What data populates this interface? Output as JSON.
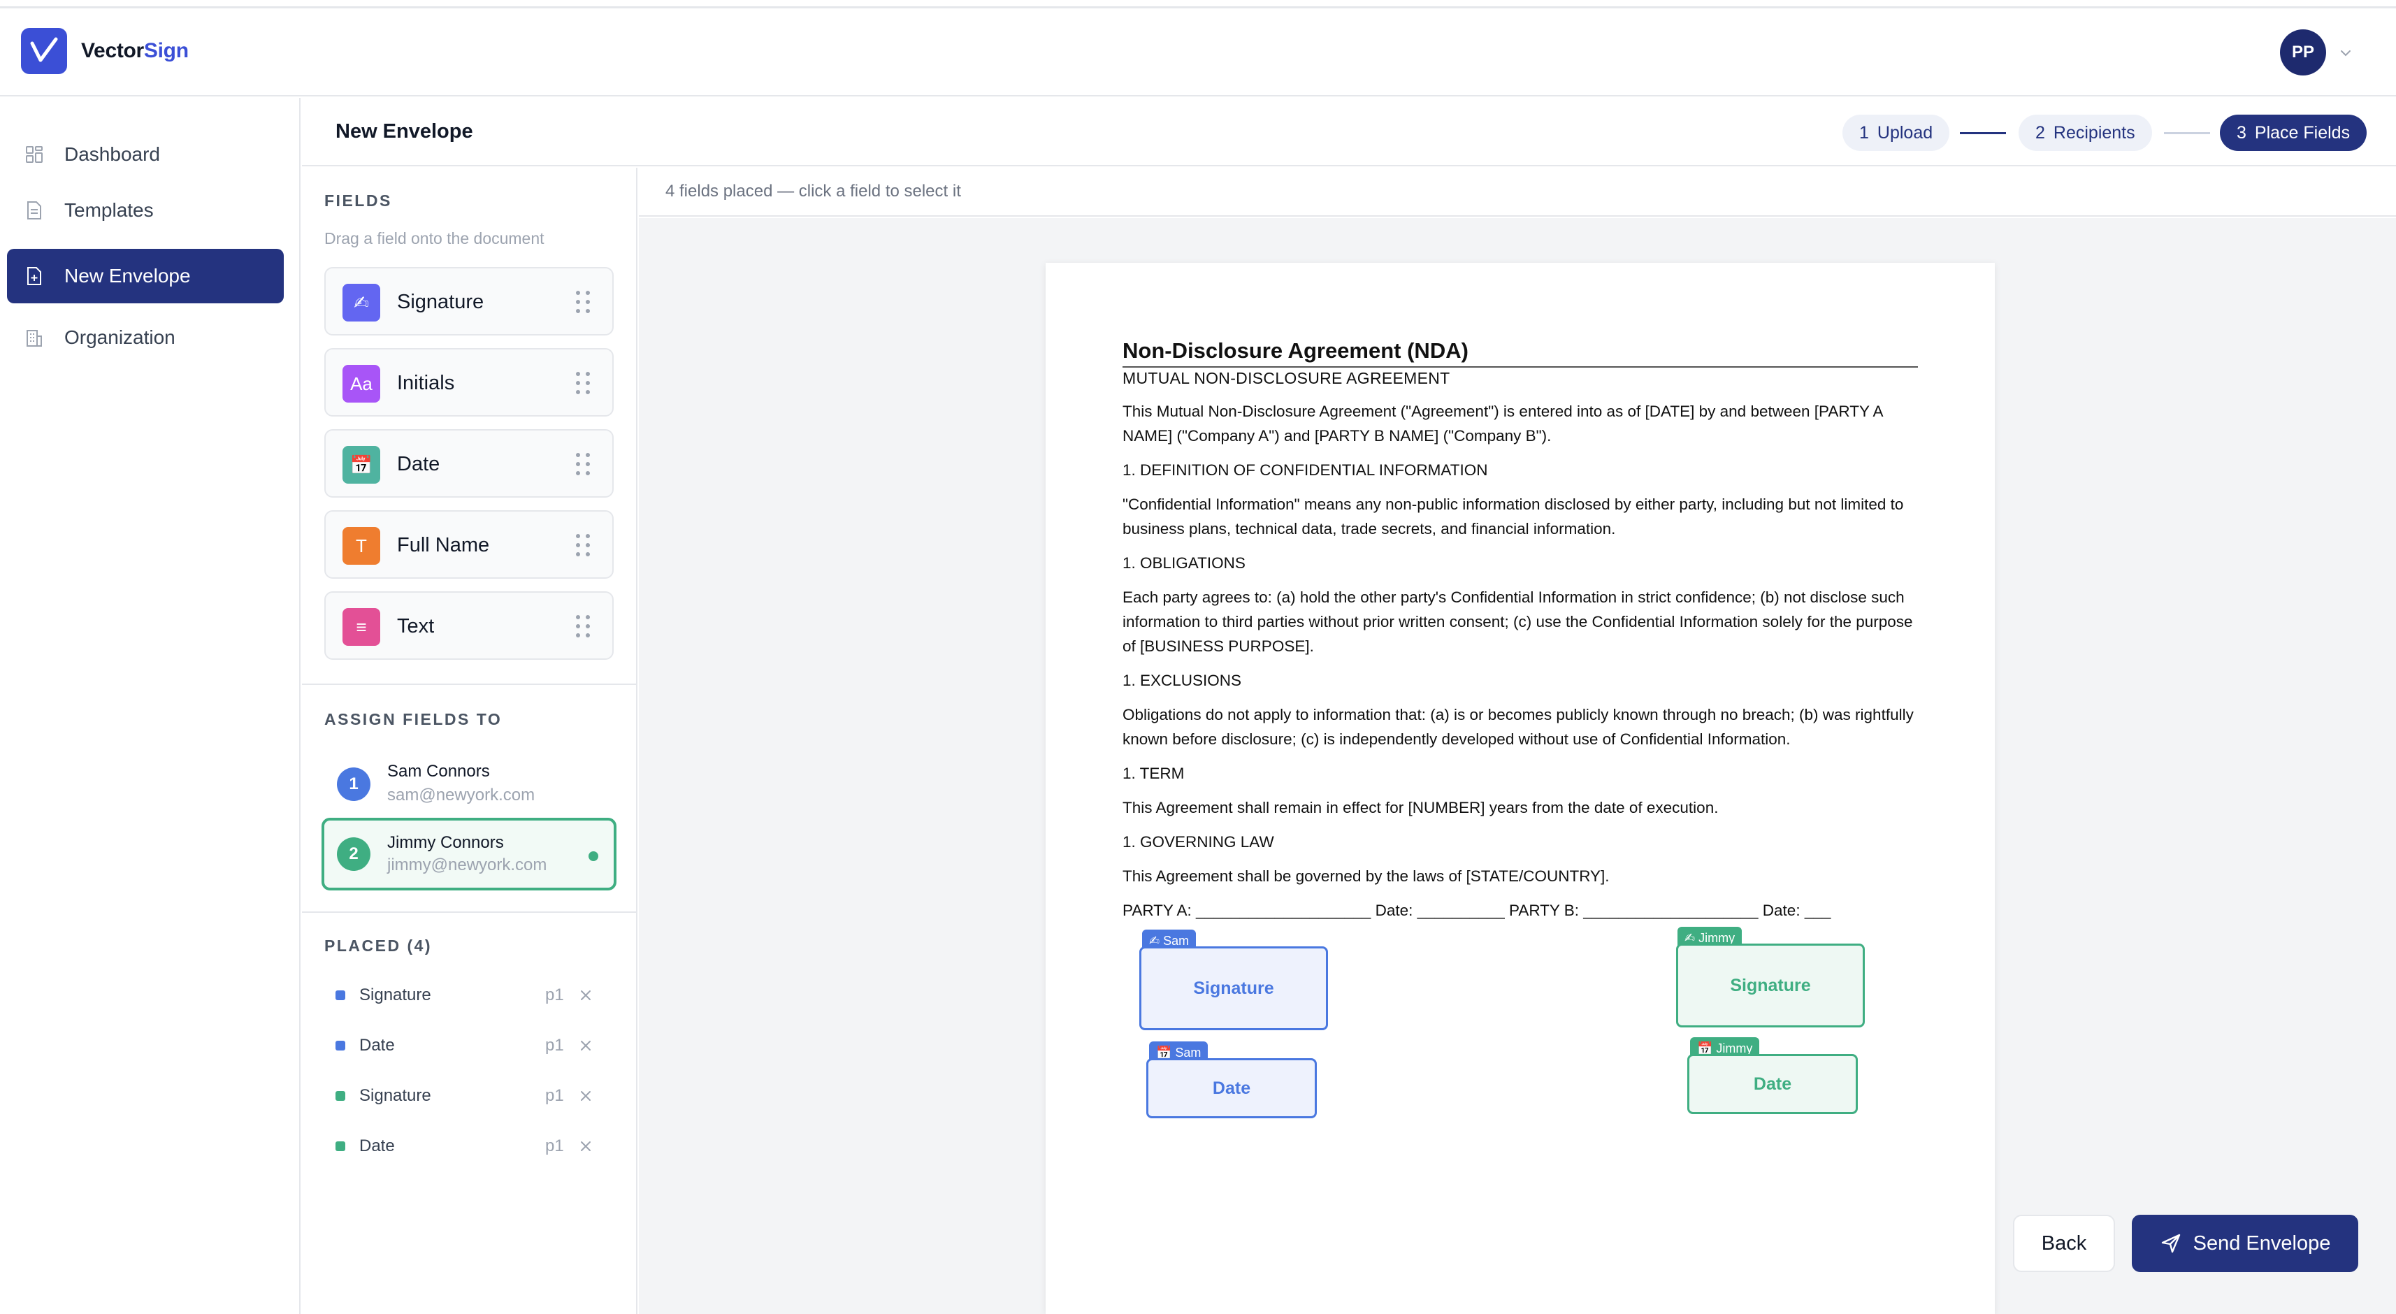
{
  "app": {
    "brand_part1": "Vector",
    "brand_part2": "Sign",
    "user_initials": "PP"
  },
  "nav": {
    "items": [
      {
        "label": "Dashboard",
        "icon": "grid-icon",
        "active": false
      },
      {
        "label": "Templates",
        "icon": "document-icon",
        "active": false
      },
      {
        "label": "New Envelope",
        "icon": "file-plus-icon",
        "active": true
      },
      {
        "label": "Organization",
        "icon": "building-icon",
        "active": false
      }
    ]
  },
  "page": {
    "title": "New Envelope",
    "steps": [
      {
        "num": "1",
        "label": "Upload"
      },
      {
        "num": "2",
        "label": "Recipients"
      },
      {
        "num": "3",
        "label": "Place Fields",
        "active": true
      }
    ]
  },
  "fields_panel": {
    "title": "FIELDS",
    "hint": "Drag a field onto the document",
    "fields": [
      {
        "label": "Signature",
        "icon": "✍",
        "color": "#6366f1"
      },
      {
        "label": "Initials",
        "icon": "Aa",
        "color": "#a855f7"
      },
      {
        "label": "Date",
        "icon": "📅",
        "color": "#4fb3a0"
      },
      {
        "label": "Full Name",
        "icon": "T",
        "color": "#ef7d2f"
      },
      {
        "label": "Text",
        "icon": "≡",
        "color": "#e35096"
      }
    ]
  },
  "assign": {
    "title": "ASSIGN FIELDS TO",
    "recipients": [
      {
        "num": "1",
        "name": "Sam Connors",
        "email": "sam@newyork.com",
        "color": "#4a78e0",
        "selected": false
      },
      {
        "num": "2",
        "name": "Jimmy Connors",
        "email": "jimmy@newyork.com",
        "color": "#3fae82",
        "selected": true
      }
    ]
  },
  "placed": {
    "title": "PLACED (4)",
    "items": [
      {
        "label": "Signature",
        "page": "p1",
        "color": "#4a78e0"
      },
      {
        "label": "Date",
        "page": "p1",
        "color": "#4a78e0"
      },
      {
        "label": "Signature",
        "page": "p1",
        "color": "#3fae82"
      },
      {
        "label": "Date",
        "page": "p1",
        "color": "#3fae82"
      }
    ]
  },
  "canvas": {
    "status": "4 fields placed — click a field to select it"
  },
  "document": {
    "title": "Non-Disclosure Agreement (NDA)",
    "subtitle": "MUTUAL NON-DISCLOSURE AGREEMENT",
    "paragraphs": [
      "This Mutual Non-Disclosure Agreement (\"Agreement\") is entered into as of [DATE] by and between [PARTY A NAME] (\"Company A\") and [PARTY B NAME] (\"Company B\").",
      "1. DEFINITION OF CONFIDENTIAL INFORMATION",
      "\"Confidential Information\" means any non-public information disclosed by either party, including but not limited to business plans, technical data, trade secrets, and financial information.",
      "1. OBLIGATIONS",
      "Each party agrees to: (a) hold the other party's Confidential Information in strict confidence; (b) not disclose such information to third parties without prior written consent; (c) use the Confidential Information solely for the purpose of [BUSINESS PURPOSE].",
      "1. EXCLUSIONS",
      "Obligations do not apply to information that: (a) is or becomes publicly known through no breach; (b) was rightfully known before disclosure; (c) is independently developed without use of Confidential Information.",
      "1. TERM",
      "This Agreement shall remain in effect for [NUMBER] years from the date of execution.",
      "1. GOVERNING LAW",
      "This Agreement shall be governed by the laws of [STATE/COUNTRY].",
      "PARTY A: ____________________ Date: __________ PARTY B: ____________________ Date: ___"
    ],
    "placed_fields": [
      {
        "label": "Signature",
        "tag": "✍ Sam",
        "owner": "sam"
      },
      {
        "label": "Date",
        "tag": "📅 Sam",
        "owner": "sam"
      },
      {
        "label": "Signature",
        "tag": "✍ Jimmy",
        "owner": "jim"
      },
      {
        "label": "Date",
        "tag": "📅 Jimmy",
        "owner": "jim"
      }
    ]
  },
  "actions": {
    "back": "Back",
    "send": "Send Envelope"
  }
}
